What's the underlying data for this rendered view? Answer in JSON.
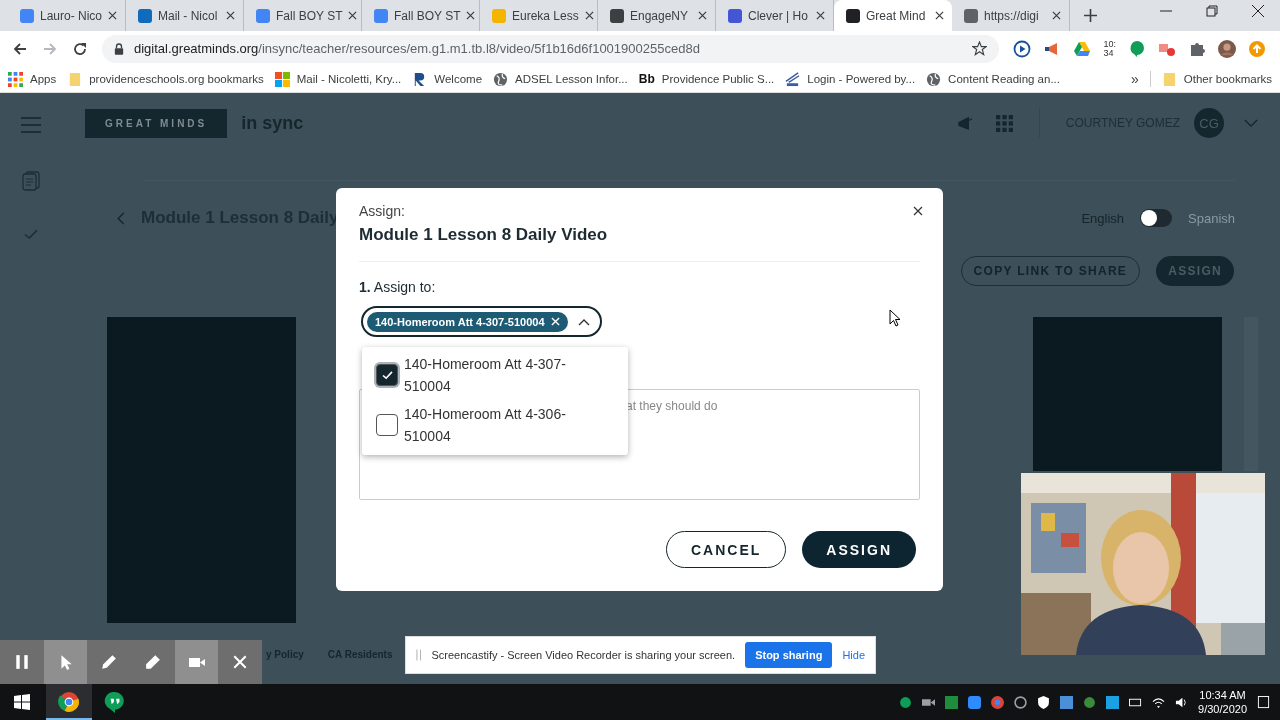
{
  "browser": {
    "tabs": [
      {
        "title": "Lauro- Nico",
        "color": "#4285f4",
        "selected": false
      },
      {
        "title": "Mail - Nicol",
        "color": "#0f6cbd",
        "selected": false
      },
      {
        "title": "Fall BOY ST",
        "color": "#4285f4",
        "selected": false
      },
      {
        "title": "Fall BOY ST",
        "color": "#4285f4",
        "selected": false
      },
      {
        "title": "Eureka Less",
        "color": "#f4b400",
        "selected": false
      },
      {
        "title": "EngageNY",
        "color": "#3c4043",
        "selected": false
      },
      {
        "title": "Clever | Ho",
        "color": "#4356d6",
        "selected": false
      },
      {
        "title": "Great Mind",
        "color": "#202124",
        "selected": true
      },
      {
        "title": "https://digi",
        "color": "#5f6368",
        "selected": false
      }
    ],
    "forward_disabled": true,
    "url_host": "digital.greatminds.org",
    "url_path": "/insync/teacher/resources/em.g1.m1.tb.l8/video/5f1b16d6f1001900255ced8d",
    "extension_clock": [
      "10:",
      "34"
    ],
    "bookmarks": [
      {
        "label": "Apps",
        "kind": "apps"
      },
      {
        "label": "providenceschools.org bookmarks",
        "kind": "folder"
      },
      {
        "label": "Mail - Nicoletti, Kry...",
        "kind": "tiles"
      },
      {
        "label": "Welcome",
        "kind": "letter"
      },
      {
        "label": "ADSEL Lesson Infor...",
        "kind": "globe"
      },
      {
        "label": "Providence Public S...",
        "kind": "mark",
        "mark": "Bb"
      },
      {
        "label": "Login - Powered by...",
        "kind": "sky"
      },
      {
        "label": "Content Reading an...",
        "kind": "globe"
      }
    ],
    "more_bookmarks": "»",
    "other_bookmarks": "Other bookmarks"
  },
  "app": {
    "logo": "GREAT MINDS",
    "product": "in sync",
    "user_name": "COURTNEY GOMEZ",
    "avatar": "CG",
    "page_title": "Module 1 Lesson 8 Daily",
    "language": {
      "left": "English",
      "right": "Spanish",
      "on": false
    },
    "actions": [
      "COPY LINK TO SHARE",
      "ASSIGN"
    ],
    "footer_links": [
      "y Policy",
      "CA Residents"
    ]
  },
  "dialog": {
    "caption": "Assign:",
    "title": "Module 1 Lesson 8 Daily Video",
    "step_number": "1.",
    "step_label": "Assign to:",
    "chip": "140-Homeroom Att 4-307-510004",
    "expanded": true,
    "options": [
      {
        "label": "140-Homeroom Att 4-307-510004",
        "checked": true
      },
      {
        "label": "140-Homeroom Att 4-306-510004",
        "checked": false
      }
    ],
    "placeholder": "at they should do",
    "buttons": [
      {
        "label": "CANCEL",
        "kind": "secondary"
      },
      {
        "label": "ASSIGN",
        "kind": "primary"
      }
    ]
  },
  "recorder": {
    "tools": [
      {
        "kind": "pause",
        "on": false
      },
      {
        "kind": "pointer",
        "on": true
      },
      {
        "kind": "pen",
        "on": false
      },
      {
        "kind": "marker",
        "on": false
      },
      {
        "kind": "camera",
        "on": true
      },
      {
        "kind": "close",
        "on": false
      }
    ]
  },
  "share_banner": {
    "message": "Screencastify - Screen Video Recorder is sharing your screen.",
    "stop": "Stop sharing",
    "hide": "Hide"
  },
  "taskbar": {
    "apps": [
      {
        "kind": "browser",
        "selected": true
      },
      {
        "kind": "chat",
        "selected": false
      }
    ],
    "time": "10:34 AM",
    "date": "9/30/2020"
  }
}
